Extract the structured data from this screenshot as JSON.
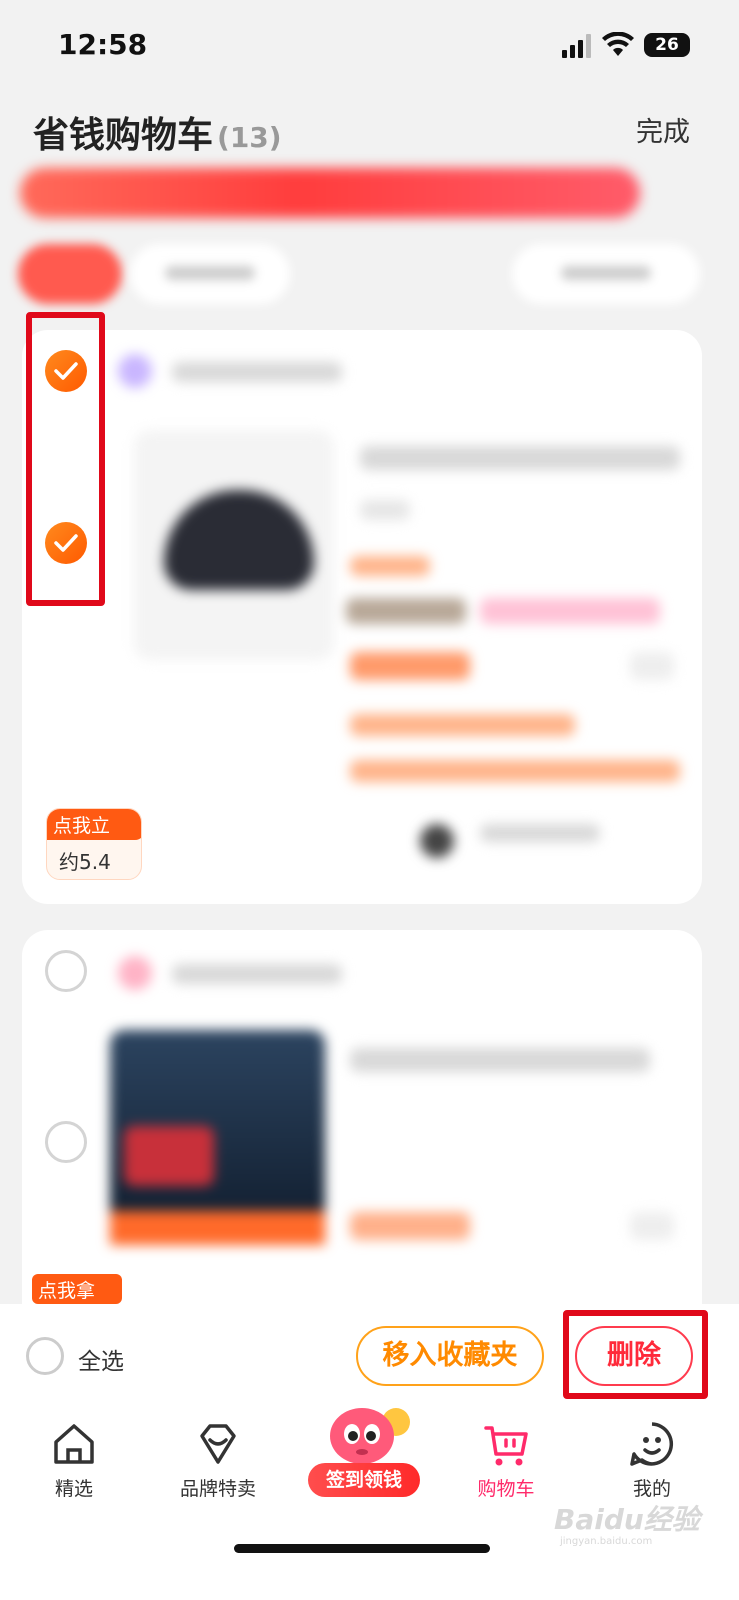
{
  "status_bar": {
    "time": "12:58",
    "battery": "26"
  },
  "header": {
    "title": "省钱购物车",
    "count": "(13)",
    "done_label": "完成"
  },
  "cart_items": [
    {
      "checked": true,
      "reward_label": "点我立",
      "reward_value": "约5.4"
    },
    {
      "checked": false,
      "reward_label": "点我拿"
    }
  ],
  "action_bar": {
    "select_all_label": "全选",
    "favorite_label": "移入收藏夹",
    "delete_label": "删除"
  },
  "tabs": [
    {
      "label": "精选",
      "icon": "home-icon"
    },
    {
      "label": "品牌特卖",
      "icon": "diamond-bag-icon"
    },
    {
      "label": "签到领钱",
      "icon": "mascot-icon"
    },
    {
      "label": "购物车",
      "icon": "cart-icon",
      "active": true
    },
    {
      "label": "我的",
      "icon": "profile-icon"
    }
  ],
  "colors": {
    "accent": "#ff6a00",
    "highlight": "#e0091a",
    "delete": "#ff2a3a",
    "active_tab": "#ff2a6a"
  },
  "watermark": {
    "brand": "Baidu经验",
    "url": "jingyan.baidu.com"
  }
}
